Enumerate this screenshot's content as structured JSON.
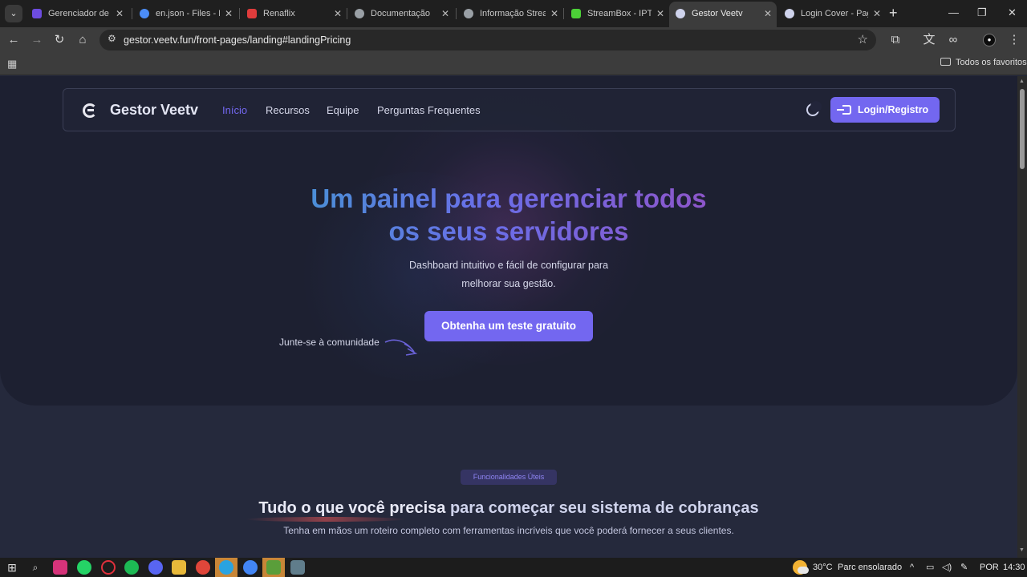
{
  "browser": {
    "tabs": [
      {
        "title": "Gerenciador de A",
        "favicon_color": "#6d4ce0"
      },
      {
        "title": "en.json - Files - Fil",
        "favicon_color": "#4b8df8"
      },
      {
        "title": "Renaflix",
        "favicon_color": "#e03c3c"
      },
      {
        "title": "Documentação",
        "favicon_color": "#9aa0a6"
      },
      {
        "title": "Informação Stream",
        "favicon_color": "#9aa0a6"
      },
      {
        "title": "StreamBox - IPTV",
        "favicon_color": "#4cd137"
      },
      {
        "title": "Gestor Veetv",
        "favicon_color": "#cfd3ec"
      },
      {
        "title": "Login Cover - Pag",
        "favicon_color": "#cfd3ec"
      }
    ],
    "active_tab_index": 6,
    "url": "gestor.veetv.fun/front-pages/landing#landingPricing",
    "bookmarks_folder": "Todos os favoritos",
    "icons": {
      "tab_search": "chevron-down-icon",
      "new_tab": "+",
      "back": "←",
      "forward": "→",
      "reload": "↻",
      "home": "⌂",
      "star": "☆",
      "minimize": "—",
      "maximize": "❐",
      "close": "✕",
      "tab_close": "✕"
    }
  },
  "navbar": {
    "brand": "Gestor Veetv",
    "links": [
      "Início",
      "Recursos",
      "Equipe",
      "Perguntas Frequentes"
    ],
    "active_link": "Início",
    "login_label": "Login/Registro"
  },
  "hero": {
    "title": "Um painel para gerenciar todos os seus servidores",
    "subtitle": "Dashboard intuitivo e fácil de configurar para melhorar sua gestão.",
    "cta_label": "Obtenha um teste gratuito",
    "community_label": "Junte-se à comunidade"
  },
  "features": {
    "badge": "Funcionalidades Úteis",
    "title_bold": "Tudo o que você precisa",
    "title_rest": "para começar seu sistema de cobranças",
    "subtitle": "Tenha em mãos um roteiro completo com ferramentas incríveis que você poderá fornecer a seus clientes."
  },
  "taskbar": {
    "weather_temp": "30°C",
    "weather_text": "Parc ensolarado",
    "language": "POR",
    "time": "14:30"
  },
  "colors": {
    "primary": "#7367f0",
    "hero_bg": "#1d2031",
    "page_bg": "#25293c"
  }
}
